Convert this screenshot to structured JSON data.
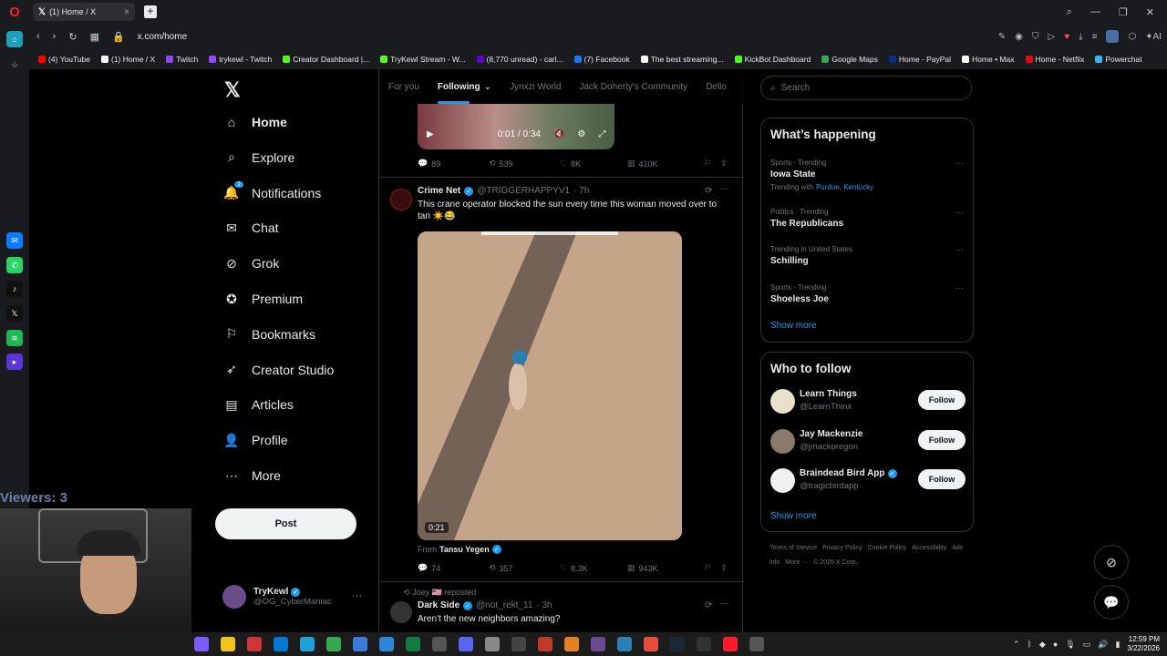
{
  "browser": {
    "tab_title": "(1) Home / X",
    "url": "x.com/home",
    "bookmarks": [
      {
        "label": "(4) YouTube",
        "color": "#ff0000"
      },
      {
        "label": "(1) Home / X",
        "color": "#ffffff"
      },
      {
        "label": "Twitch",
        "color": "#9146ff"
      },
      {
        "label": "trykewl - Twitch",
        "color": "#9146ff"
      },
      {
        "label": "Creator Dashboard |...",
        "color": "#53fc18"
      },
      {
        "label": "TryKewl Stream - W...",
        "color": "#53fc18"
      },
      {
        "label": "(8,770 unread) - carl...",
        "color": "#6001d2"
      },
      {
        "label": "(7) Facebook",
        "color": "#1877f2"
      },
      {
        "label": "The best streaming...",
        "color": "#ffffff"
      },
      {
        "label": "KickBot Dashboard",
        "color": "#53fc18"
      },
      {
        "label": "Google Maps",
        "color": "#34a853"
      },
      {
        "label": "Home - PayPal",
        "color": "#003087"
      },
      {
        "label": "Home • Max",
        "color": "#ffffff"
      },
      {
        "label": "Home - Netflix",
        "color": "#e50914"
      },
      {
        "label": "Powerchat",
        "color": "#3ab4f2"
      }
    ]
  },
  "nav": {
    "items": [
      {
        "label": "Home",
        "icon": "home-icon"
      },
      {
        "label": "Explore",
        "icon": "search-icon"
      },
      {
        "label": "Notifications",
        "icon": "bell-icon",
        "badge": "1"
      },
      {
        "label": "Chat",
        "icon": "envelope-icon"
      },
      {
        "label": "Grok",
        "icon": "grok-icon"
      },
      {
        "label": "Premium",
        "icon": "verified-icon"
      },
      {
        "label": "Bookmarks",
        "icon": "bookmark-icon"
      },
      {
        "label": "Creator Studio",
        "icon": "rocket-icon"
      },
      {
        "label": "Articles",
        "icon": "article-icon"
      },
      {
        "label": "Profile",
        "icon": "person-icon"
      },
      {
        "label": "More",
        "icon": "more-icon"
      }
    ],
    "post_label": "Post",
    "account": {
      "name": "TryKewl",
      "handle": "@OG_CyberManiac"
    }
  },
  "feed": {
    "tabs": [
      "For you",
      "Following",
      "Jynxzi World",
      "Jack Doherty's Community",
      "Dello"
    ],
    "active_tab": "Following",
    "video1": {
      "time": "0:01 / 0:34"
    },
    "tweet0_stats": {
      "replies": "89",
      "reposts": "539",
      "likes": "8K",
      "views": "410K"
    },
    "tweet1": {
      "name": "Crime Net",
      "handle": "@TRIGGERHAPPYV1",
      "time": "· 7h",
      "text": "This crane operator blocked the sun every time this woman moved over to tan ☀️😂",
      "video_duration": "0:21",
      "from_label": "From",
      "from_name": "Tansu Yegen",
      "replies": "74",
      "reposts": "357",
      "likes": "8.3K",
      "views": "943K"
    },
    "tweet2": {
      "repost_by": "Joey 🇺🇸 reposted",
      "name": "Dark Side",
      "handle": "@not_rekt_11",
      "time": "· 3h",
      "text": "Aren't the new neighbors amazing?"
    }
  },
  "sidebar": {
    "search_placeholder": "Search",
    "happening_title": "What’s happening",
    "trends": [
      {
        "context": "Sports · Trending",
        "title": "Iowa State",
        "with_label": "Trending with",
        "with_links": "Purdue, Kentucky"
      },
      {
        "context": "Politics · Trending",
        "title": "The Republicans"
      },
      {
        "context": "Trending in United States",
        "title": "Schilling"
      },
      {
        "context": "Sports · Trending",
        "title": "Shoeless Joe"
      }
    ],
    "show_more": "Show more",
    "who_title": "Who to follow",
    "follow": [
      {
        "name": "Learn Things",
        "handle": "@LearnThinx",
        "verified": false
      },
      {
        "name": "Jay Mackenzie",
        "handle": "@jmackoregon",
        "verified": false
      },
      {
        "name": "Braindead Bird App",
        "handle": "@tragicbirdapp",
        "verified": true
      }
    ],
    "follow_label": "Follow",
    "show_more2": "Show more",
    "legal": [
      "Terms of Service",
      "Privacy Policy",
      "Cookie Policy",
      "Accessibility",
      "Ads info",
      "More ···",
      "© 2026 X Corp."
    ]
  },
  "overlay": {
    "viewers": "Viewers: 3"
  },
  "taskbar": {
    "time": "12:59 PM",
    "date": "3/22/2026"
  }
}
